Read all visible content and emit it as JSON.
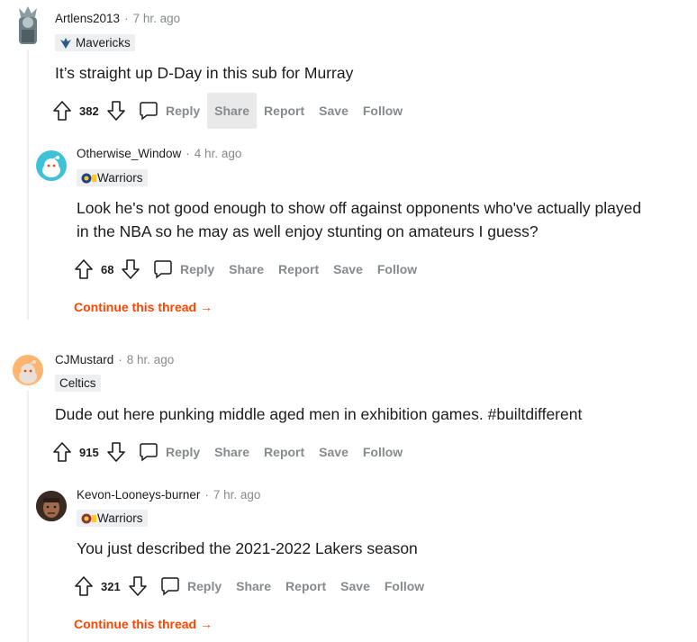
{
  "comments": [
    {
      "author": "Artlens2013",
      "time": "7 hr. ago",
      "flair": "Mavericks",
      "body": "It’s straight up D-Day in this sub for Murray",
      "score": "382",
      "actions": {
        "reply": "Reply",
        "share": "Share",
        "report": "Report",
        "save": "Save",
        "follow": "Follow"
      },
      "reply": {
        "author": "Otherwise_Window",
        "time": "4 hr. ago",
        "flair": "Warriors",
        "body_line1": "Look he's not good enough to show off against opponents who've actually played",
        "body_line2": "in the NBA so he may as well enjoy stunting on amateurs I guess?",
        "score": "68",
        "actions": {
          "reply": "Reply",
          "share": "Share",
          "report": "Report",
          "save": "Save",
          "follow": "Follow"
        },
        "continue": "Continue this thread →"
      }
    },
    {
      "author": "CJMustard",
      "time": "8 hr. ago",
      "flair": "Celtics",
      "body": "Dude out here punking middle aged men in exhibition games. #builtdifferent",
      "score": "915",
      "actions": {
        "reply": "Reply",
        "share": "Share",
        "report": "Report",
        "save": "Save",
        "follow": "Follow"
      },
      "reply": {
        "author": "Kevon-Looneys-burner",
        "time": "7 hr. ago",
        "flair": "Warriors",
        "body": "You just described the 2021-2022 Lakers season",
        "score": "321",
        "actions": {
          "reply": "Reply",
          "share": "Share",
          "report": "Report",
          "save": "Save",
          "follow": "Follow"
        },
        "continue": "Continue this thread →"
      }
    }
  ],
  "separator": "·",
  "colors": {
    "accent": "#ff4500",
    "muted": "#878a8c",
    "flair_bg": "#edeff1",
    "thread_line": "#edeff1"
  }
}
